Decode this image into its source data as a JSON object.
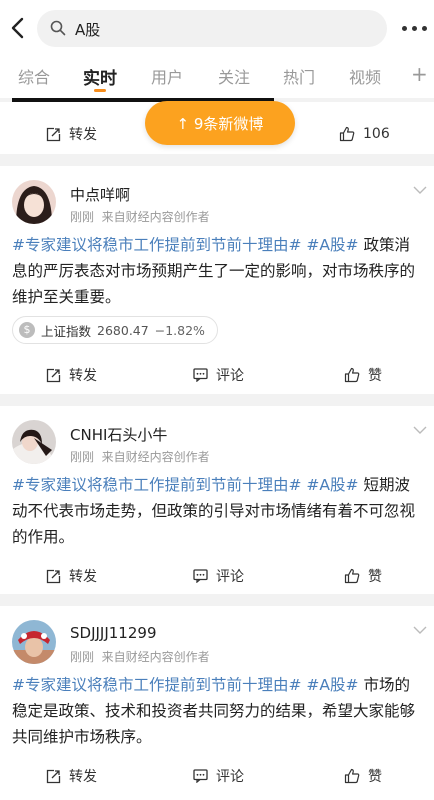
{
  "search": {
    "query": "A股"
  },
  "tabs": [
    "综合",
    "实时",
    "用户",
    "关注",
    "热门",
    "视频"
  ],
  "tabs_active_index": 1,
  "new_posts_label": "↑ 9条新微博",
  "first_card": {
    "repost": "转发",
    "likes": "106"
  },
  "posts": [
    {
      "user": "中点咩啊",
      "time": "刚刚",
      "source": "来自财经内容创作者",
      "tag1": "#专家建议将稳市工作提前到节前十理由#",
      "tag2": "#A股#",
      "text": "政策消息的严厉表态对市场预期产生了一定的影响，对市场秩序的维护至关重要。",
      "stock": {
        "name": "上证指数",
        "value": "2680.47",
        "change": "−1.82%"
      },
      "repost": "转发",
      "comment": "评论",
      "like": "赞"
    },
    {
      "user": "CNHI石头小牛",
      "time": "刚刚",
      "source": "来自财经内容创作者",
      "tag1": "#专家建议将稳市工作提前到节前十理由#",
      "tag2": "#A股#",
      "text": "短期波动不代表市场走势，但政策的引导对市场情绪有着不可忽视的作用。",
      "repost": "转发",
      "comment": "评论",
      "like": "赞"
    },
    {
      "user": "SDJJJJ11299",
      "time": "刚刚",
      "source": "来自财经内容创作者",
      "tag1": "#专家建议将稳市工作提前到节前十理由#",
      "tag2": "#A股#",
      "text": "市场的稳定是政策、技术和投资者共同努力的结果，希望大家能够共同维护市场秩序。",
      "repost": "转发",
      "comment": "评论",
      "like": "赞"
    }
  ],
  "colors": {
    "accent": "#f78d1c",
    "button": "#fca21f",
    "link": "#4a7fbb"
  }
}
